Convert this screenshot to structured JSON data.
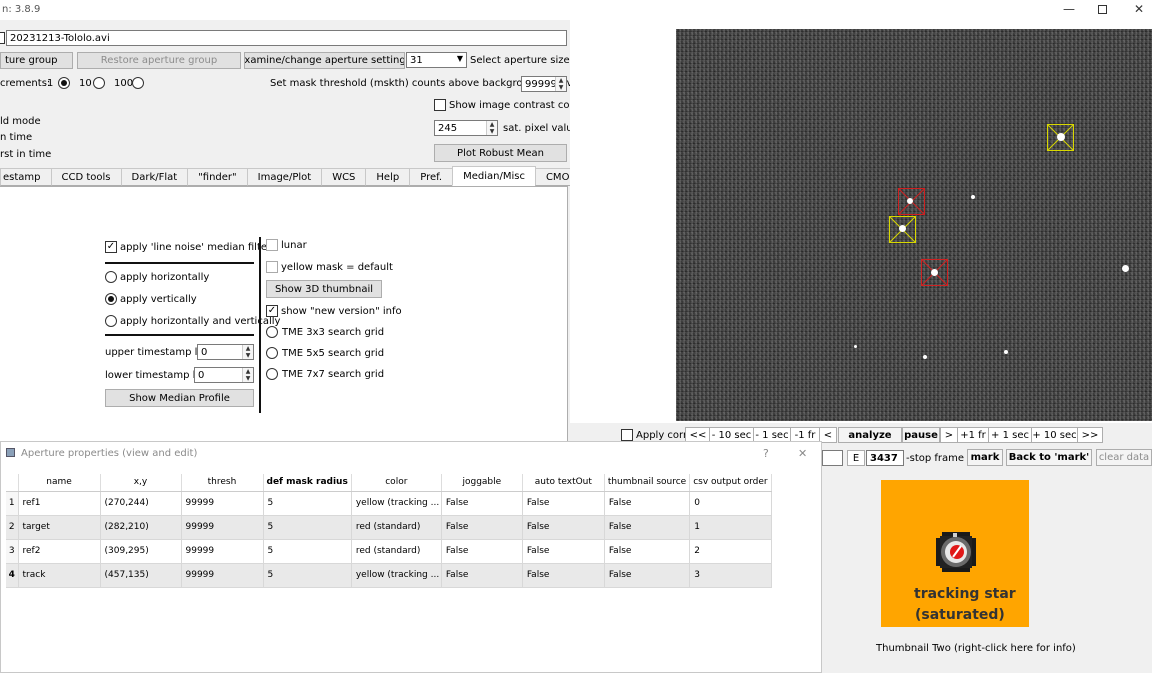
{
  "window": {
    "title_fragment": "n: 3.8.9"
  },
  "file": {
    "name": "20231213-Tololo.avi"
  },
  "aperture_row": {
    "group_label": "ture group",
    "restore_label": "Restore aperture group",
    "examine_label": "Examine/change aperture settings",
    "size_value": "31",
    "size_label": "Select aperture size"
  },
  "increments": {
    "label": "crements:",
    "options": [
      "1",
      "10",
      "100"
    ],
    "selected": "1"
  },
  "mask": {
    "label": "Set mask threshold (mskth) counts above background (bkavg)",
    "value": "99999"
  },
  "left_fragments": [
    "ld mode",
    "n time",
    "rst in time"
  ],
  "contrast": {
    "label": "Show image contrast control"
  },
  "saturation": {
    "value": "245",
    "label": "sat. pixel value"
  },
  "robust_mean_label": "Plot Robust Mean",
  "tabs": [
    "estamp",
    "CCD tools",
    "Dark/Flat",
    "\"finder\"",
    "Image/Plot",
    "WCS",
    "Help",
    "Pref.",
    "Median/Misc",
    "CMOS tools"
  ],
  "active_tab": "Median/Misc",
  "median_panel": {
    "line_noise_label": "apply 'line noise' median filter",
    "horizontal_label": "apply horizontally",
    "vertical_label": "apply vertically",
    "both_label": "apply horizontally and vertically",
    "upper_label": "upper timestamp limit",
    "upper_value": "0",
    "lower_label": "lower timestamp limit",
    "lower_value": "0",
    "profile_button": "Show Median Profile"
  },
  "misc_panel": {
    "lunar_label": "lunar",
    "yellow_mask_label": "yellow mask = default",
    "thumb3d_button": "Show 3D thumbnail",
    "new_version_label": "show \"new version\" info",
    "tme3_label": "TME 3x3 search grid",
    "tme5_label": "TME 5x5 search grid",
    "tme7_label": "TME 7x7 search grid"
  },
  "playback": {
    "apply_corr_label": "Apply corr",
    "buttons": [
      "<<",
      "- 10 sec",
      "- 1 sec",
      "-1 fr",
      "<",
      "analyze",
      "pause",
      ">",
      "+1 fr",
      "+ 1 sec",
      "+ 10 sec",
      ">>"
    ]
  },
  "frame_row": {
    "e_label": "E",
    "frame_value": "3437",
    "stop_label": "-stop frame",
    "mark_label": "mark",
    "back_label": "Back to 'mark'",
    "clear_label": "clear data"
  },
  "thumbnail": {
    "line1": "tracking star",
    "line2": "(saturated)",
    "caption": "Thumbnail Two (right-click here for info)",
    "bg_color": "#ffa500"
  },
  "aperture_props": {
    "title": "Aperture properties (view and edit)",
    "help": "?",
    "close": "✕",
    "columns": [
      "name",
      "x,y",
      "thresh",
      "def mask radius",
      "color",
      "joggable",
      "auto textOut",
      "thumbnail source",
      "csv output order"
    ],
    "rows": [
      [
        "ref1",
        "(270,244)",
        "99999",
        "5",
        "yellow (tracking ...",
        "False",
        "False",
        "False",
        "0"
      ],
      [
        "target",
        "(282,210)",
        "99999",
        "5",
        "red (standard)",
        "False",
        "False",
        "False",
        "1"
      ],
      [
        "ref2",
        "(309,295)",
        "99999",
        "5",
        "red (standard)",
        "False",
        "False",
        "False",
        "2"
      ],
      [
        "track",
        "(457,135)",
        "99999",
        "5",
        "yellow (tracking ...",
        "False",
        "False",
        "False",
        "3"
      ]
    ],
    "row_numbers": [
      "1",
      "2",
      "3",
      "4"
    ]
  }
}
